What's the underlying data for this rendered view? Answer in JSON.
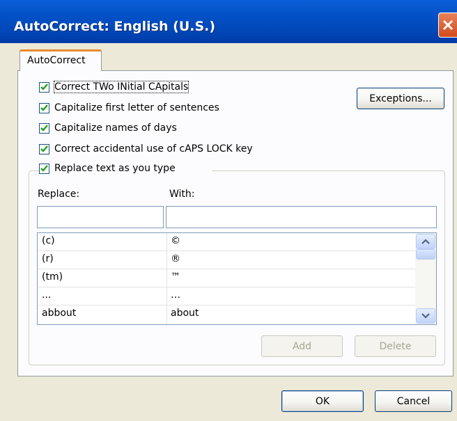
{
  "window": {
    "title": "AutoCorrect: English (U.S.)"
  },
  "tabs": [
    {
      "label": "AutoCorrect"
    }
  ],
  "options": [
    {
      "label": "Correct TWo INitial CApitals",
      "checked": true
    },
    {
      "label": "Capitalize first letter of sentences",
      "checked": true
    },
    {
      "label": "Capitalize names of days",
      "checked": true
    },
    {
      "label": "Correct accidental use of cAPS LOCK key",
      "checked": true
    },
    {
      "label": "Replace text as you type",
      "checked": true
    }
  ],
  "exceptions_button": "Exceptions...",
  "replace": {
    "replace_label": "Replace:",
    "with_label": "With:",
    "replace_value": "",
    "with_value": "",
    "entries": [
      {
        "replace": "(c)",
        "with": "©"
      },
      {
        "replace": "(r)",
        "with": "®"
      },
      {
        "replace": "(tm)",
        "with": "™"
      },
      {
        "replace": "...",
        "with": "…"
      },
      {
        "replace": "abbout",
        "with": "about"
      }
    ]
  },
  "buttons": {
    "add": "Add",
    "delete": "Delete",
    "ok": "OK",
    "cancel": "Cancel"
  },
  "colors": {
    "title_bar": "#0453c9",
    "dialog_bg": "#ece9d8",
    "check": "#21a121",
    "close": "#d24b1d"
  }
}
